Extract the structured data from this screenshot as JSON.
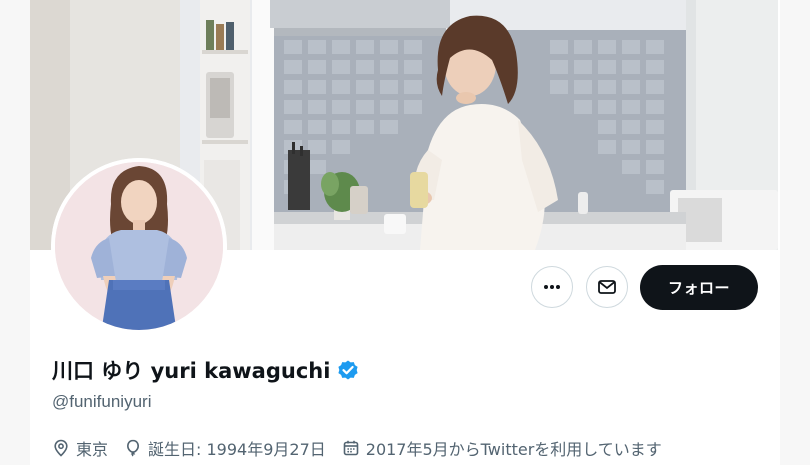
{
  "profile": {
    "display_name": "川口 ゆり yuri kawaguchi",
    "handle": "@funifuniyuri",
    "verified": true
  },
  "actions": {
    "more_icon": "more-horizontal-icon",
    "message_icon": "envelope-icon",
    "follow_label": "フォロー"
  },
  "meta": {
    "location": "東京",
    "birthday": "誕生日: 1994年9月27日",
    "joined": "2017年5月からTwitterを利用しています"
  },
  "colors": {
    "follow_bg": "#0f1419",
    "verified_blue": "#1d9bf0",
    "secondary_text": "#536471",
    "border": "#cfd9de"
  }
}
